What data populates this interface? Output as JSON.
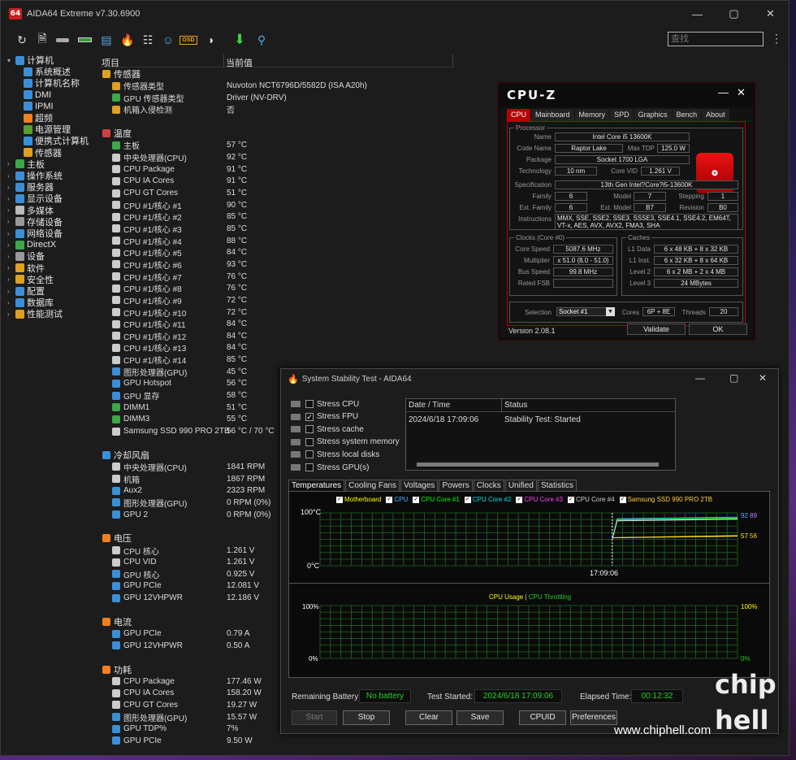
{
  "app": {
    "title": "AIDA64 Extreme v7.30.6900",
    "icon_text": "64"
  },
  "search": {
    "placeholder": "查找"
  },
  "toolbar": {
    "osd_label": "OSD"
  },
  "tree": [
    {
      "label": "计算机",
      "level": 0,
      "expanded": true,
      "color": "#3b8fd9"
    },
    {
      "label": "系统概述",
      "level": 1,
      "color": "#3b8fd9"
    },
    {
      "label": "计算机名称",
      "level": 1,
      "color": "#3b8fd9"
    },
    {
      "label": "DMI",
      "level": 1,
      "color": "#3b8fd9"
    },
    {
      "label": "IPMI",
      "level": 1,
      "color": "#3b8fd9"
    },
    {
      "label": "超频",
      "level": 1,
      "color": "#f08020"
    },
    {
      "label": "电源管理",
      "level": 1,
      "color": "#5aa030"
    },
    {
      "label": "便携式计算机",
      "level": 1,
      "color": "#3b8fd9"
    },
    {
      "label": "传感器",
      "level": 1,
      "color": "#e0a020"
    },
    {
      "label": "主板",
      "level": 0,
      "color": "#3ca84a"
    },
    {
      "label": "操作系统",
      "level": 0,
      "color": "#3b8fd9"
    },
    {
      "label": "服务器",
      "level": 0,
      "color": "#3b8fd9"
    },
    {
      "label": "显示设备",
      "level": 0,
      "color": "#3b8fd9"
    },
    {
      "label": "多媒体",
      "level": 0,
      "color": "#bbbbbb"
    },
    {
      "label": "存储设备",
      "level": 0,
      "color": "#999999"
    },
    {
      "label": "网络设备",
      "level": 0,
      "color": "#3b8fd9"
    },
    {
      "label": "DirectX",
      "level": 0,
      "color": "#3ca84a"
    },
    {
      "label": "设备",
      "level": 0,
      "color": "#999999"
    },
    {
      "label": "软件",
      "level": 0,
      "color": "#e0a020"
    },
    {
      "label": "安全性",
      "level": 0,
      "color": "#e0a020"
    },
    {
      "label": "配置",
      "level": 0,
      "color": "#3b8fd9"
    },
    {
      "label": "数据库",
      "level": 0,
      "color": "#3b8fd9"
    },
    {
      "label": "性能测试",
      "level": 0,
      "color": "#e0a020"
    }
  ],
  "list": {
    "col_item": "项目",
    "col_value": "当前值"
  },
  "sensors": [
    {
      "type": "section",
      "label": "传感器",
      "color": "#e0a020"
    },
    {
      "type": "item",
      "label": "传感器类型",
      "value": "Nuvoton NCT6796D/5582D  (ISA A20h)",
      "color": "#e0a020"
    },
    {
      "type": "item",
      "label": "GPU 传感器类型",
      "value": "Driver  (NV-DRV)",
      "color": "#3ca84a"
    },
    {
      "type": "item",
      "label": "机箱入侵检测",
      "value": "否",
      "color": "#e0a020"
    },
    {
      "type": "gap"
    },
    {
      "type": "section",
      "label": "温度",
      "color": "#d04040"
    },
    {
      "type": "item",
      "label": "主板",
      "value": "57 °C",
      "color": "#3ca84a"
    },
    {
      "type": "item",
      "label": "中央处理器(CPU)",
      "value": "92 °C",
      "color": "#cccccc"
    },
    {
      "type": "item",
      "label": "CPU Package",
      "value": "91 °C",
      "color": "#cccccc"
    },
    {
      "type": "item",
      "label": "CPU IA Cores",
      "value": "91 °C",
      "color": "#cccccc"
    },
    {
      "type": "item",
      "label": "CPU GT Cores",
      "value": "51 °C",
      "color": "#cccccc"
    },
    {
      "type": "item",
      "label": "CPU #1/核心 #1",
      "value": "90 °C",
      "color": "#cccccc"
    },
    {
      "type": "item",
      "label": "CPU #1/核心 #2",
      "value": "85 °C",
      "color": "#cccccc"
    },
    {
      "type": "item",
      "label": "CPU #1/核心 #3",
      "value": "85 °C",
      "color": "#cccccc"
    },
    {
      "type": "item",
      "label": "CPU #1/核心 #4",
      "value": "88 °C",
      "color": "#cccccc"
    },
    {
      "type": "item",
      "label": "CPU #1/核心 #5",
      "value": "84 °C",
      "color": "#cccccc"
    },
    {
      "type": "item",
      "label": "CPU #1/核心 #6",
      "value": "93 °C",
      "color": "#cccccc"
    },
    {
      "type": "item",
      "label": "CPU #1/核心 #7",
      "value": "76 °C",
      "color": "#cccccc"
    },
    {
      "type": "item",
      "label": "CPU #1/核心 #8",
      "value": "76 °C",
      "color": "#cccccc"
    },
    {
      "type": "item",
      "label": "CPU #1/核心 #9",
      "value": "72 °C",
      "color": "#cccccc"
    },
    {
      "type": "item",
      "label": "CPU #1/核心 #10",
      "value": "72 °C",
      "color": "#cccccc"
    },
    {
      "type": "item",
      "label": "CPU #1/核心 #11",
      "value": "84 °C",
      "color": "#cccccc"
    },
    {
      "type": "item",
      "label": "CPU #1/核心 #12",
      "value": "84 °C",
      "color": "#cccccc"
    },
    {
      "type": "item",
      "label": "CPU #1/核心 #13",
      "value": "84 °C",
      "color": "#cccccc"
    },
    {
      "type": "item",
      "label": "CPU #1/核心 #14",
      "value": "85 °C",
      "color": "#cccccc"
    },
    {
      "type": "item",
      "label": "图形处理器(GPU)",
      "value": "45 °C",
      "color": "#3b8fd9"
    },
    {
      "type": "item",
      "label": "GPU Hotspot",
      "value": "56 °C",
      "color": "#3b8fd9"
    },
    {
      "type": "item",
      "label": "GPU 显存",
      "value": "58 °C",
      "color": "#3b8fd9"
    },
    {
      "type": "item",
      "label": "DIMM1",
      "value": "51 °C",
      "color": "#3ca84a"
    },
    {
      "type": "item",
      "label": "DIMM3",
      "value": "55 °C",
      "color": "#3ca84a"
    },
    {
      "type": "item",
      "label": "Samsung SSD 990 PRO 2TB",
      "value": "56 °C / 70 °C",
      "color": "#cccccc"
    },
    {
      "type": "gap"
    },
    {
      "type": "section",
      "label": "冷却风扇",
      "color": "#3b8fd9"
    },
    {
      "type": "item",
      "label": "中央处理器(CPU)",
      "value": "1841 RPM",
      "color": "#cccccc"
    },
    {
      "type": "item",
      "label": "机箱",
      "value": "1867 RPM",
      "color": "#cccccc"
    },
    {
      "type": "item",
      "label": "Aux2",
      "value": "2323 RPM",
      "color": "#3b8fd9"
    },
    {
      "type": "item",
      "label": "图形处理器(GPU)",
      "value": "0 RPM  (0%)",
      "color": "#3b8fd9"
    },
    {
      "type": "item",
      "label": "GPU 2",
      "value": "0 RPM  (0%)",
      "color": "#3b8fd9"
    },
    {
      "type": "gap"
    },
    {
      "type": "section",
      "label": "电压",
      "color": "#f08020"
    },
    {
      "type": "item",
      "label": "CPU 核心",
      "value": "1.261 V",
      "color": "#cccccc"
    },
    {
      "type": "item",
      "label": "CPU VID",
      "value": "1.261 V",
      "color": "#cccccc"
    },
    {
      "type": "item",
      "label": "GPU 核心",
      "value": "0.925 V",
      "color": "#3b8fd9"
    },
    {
      "type": "item",
      "label": "GPU PCIe",
      "value": "12.081 V",
      "color": "#3b8fd9"
    },
    {
      "type": "item",
      "label": "GPU 12VHPWR",
      "value": "12.186 V",
      "color": "#3b8fd9"
    },
    {
      "type": "gap"
    },
    {
      "type": "section",
      "label": "电流",
      "color": "#f08020"
    },
    {
      "type": "item",
      "label": "GPU PCIe",
      "value": "0.79 A",
      "color": "#3b8fd9"
    },
    {
      "type": "item",
      "label": "GPU 12VHPWR",
      "value": "0.50 A",
      "color": "#3b8fd9"
    },
    {
      "type": "gap"
    },
    {
      "type": "section",
      "label": "功耗",
      "color": "#f08020"
    },
    {
      "type": "item",
      "label": "CPU Package",
      "value": "177.46 W",
      "color": "#cccccc"
    },
    {
      "type": "item",
      "label": "CPU IA Cores",
      "value": "158.20 W",
      "color": "#cccccc"
    },
    {
      "type": "item",
      "label": "CPU GT Cores",
      "value": "19.27 W",
      "color": "#cccccc"
    },
    {
      "type": "item",
      "label": "图形处理器(GPU)",
      "value": "15.57 W",
      "color": "#3b8fd9"
    },
    {
      "type": "item",
      "label": "GPU TDP%",
      "value": "7%",
      "color": "#3b8fd9"
    },
    {
      "type": "item",
      "label": "GPU PCIe",
      "value": "9.50 W",
      "color": "#3b8fd9"
    }
  ],
  "cpuz": {
    "title": "CPU-Z",
    "tabs": [
      "CPU",
      "Mainboard",
      "Memory",
      "SPD",
      "Graphics",
      "Bench",
      "About"
    ],
    "processor_group": "Processor",
    "name_label": "Name",
    "name": "Intel Core i5 13600K",
    "code_name_label": "Code Name",
    "code_name": "Raptor Lake",
    "max_tdp_label": "Max TDP",
    "max_tdp": "125.0 W",
    "package_label": "Package",
    "package": "Socket 1700 LGA",
    "technology_label": "Technology",
    "technology": "10 nm",
    "core_vid_label": "Core VID",
    "core_vid": "1.261 V",
    "specification_label": "Specification",
    "specification": "13th Gen Intel?Core?i5-13600K",
    "family_label": "Family",
    "family": "6",
    "model_label": "Model",
    "model": "7",
    "stepping_label": "Stepping",
    "stepping": "1",
    "ext_family_label": "Ext. Family",
    "ext_family": "6",
    "ext_model_label": "Ext. Model",
    "ext_model": "B7",
    "revision_label": "Revision",
    "revision": "B0",
    "instructions_label": "Instructions",
    "instructions": "MMX, SSE, SSE2, SSE3, SSSE3, SSE4.1, SSE4.2, EM64T, VT-x, AES, AVX, AVX2, FMA3, SHA",
    "clocks_group": "Clocks (Core #0)",
    "core_speed_label": "Core Speed",
    "core_speed": "5087.6 MHz",
    "multiplier_label": "Multiplier",
    "multiplier": "x 51.0 (8.0 - 51.0)",
    "bus_speed_label": "Bus Speed",
    "bus_speed": "99.8 MHz",
    "rated_fsb_label": "Rated FSB",
    "rated_fsb": "",
    "caches_group": "Caches",
    "l1d_label": "L1 Data",
    "l1d": "6 x 48 KB + 8 x 32 KB",
    "l1i_label": "L1 Inst.",
    "l1i": "6 x 32 KB + 8 x 64 KB",
    "l2_label": "Level 2",
    "l2": "6 x 2 MB + 2 x 4 MB",
    "l3_label": "Level 3",
    "l3": "24 MBytes",
    "selection_label": "Selection",
    "selection": "Socket #1",
    "cores_label": "Cores",
    "cores": "6P + 8E",
    "threads_label": "Threads",
    "threads": "20",
    "version": "Version 2.08.1",
    "validate": "Validate",
    "ok": "OK"
  },
  "sst": {
    "title": "System Stability Test - AIDA64",
    "stress": [
      {
        "label": "Stress CPU",
        "checked": false
      },
      {
        "label": "Stress FPU",
        "checked": true
      },
      {
        "label": "Stress cache",
        "checked": false
      },
      {
        "label": "Stress system memory",
        "checked": false
      },
      {
        "label": "Stress local disks",
        "checked": false
      },
      {
        "label": "Stress GPU(s)",
        "checked": false
      }
    ],
    "log_col_date": "Date / Time",
    "log_col_status": "Status",
    "log_date": "2024/6/18 17:09:06",
    "log_status": "Stability Test: Started",
    "tabs": [
      "Temperatures",
      "Cooling Fans",
      "Voltages",
      "Powers",
      "Clocks",
      "Unified",
      "Statistics"
    ],
    "temp_legend": [
      {
        "label": "Motherboard",
        "color": "#ffff00"
      },
      {
        "label": "CPU",
        "color": "#4fb3ff"
      },
      {
        "label": "CPU Core #1",
        "color": "#00ff00"
      },
      {
        "label": "CPU Core #2",
        "color": "#00e0e0"
      },
      {
        "label": "CPU Core #3",
        "color": "#ff40ff"
      },
      {
        "label": "CPU Core #4",
        "color": "#d0d0d0"
      },
      {
        "label": "Samsung SSD 990 PRO 2TB",
        "color": "#ffd040"
      }
    ],
    "temp_y_top": "100°C",
    "temp_y_bottom": "0°C",
    "temp_time": "17:09:06",
    "temp_right_a": "92",
    "temp_right_b": "89",
    "temp_right_c": "57",
    "temp_right_d": "56",
    "usage_legend_a": "CPU Usage",
    "usage_legend_sep": "|",
    "usage_legend_b": "CPU Throttling",
    "usage_y_top": "100%",
    "usage_y_bottom": "0%",
    "usage_right_top": "100%",
    "usage_right_bottom": "0%",
    "remaining_battery_label": "Remaining Battery:",
    "remaining_battery": "No battery",
    "test_started_label": "Test Started:",
    "test_started": "2024/6/18 17:09:06",
    "elapsed_label": "Elapsed Time:",
    "elapsed": "00:12:32",
    "buttons": {
      "start": "Start",
      "stop": "Stop",
      "clear": "Clear",
      "save": "Save",
      "cpuid": "CPUID",
      "preferences": "Preferences"
    }
  },
  "watermark": "www.chiphell.com",
  "logo": {
    "line1": "chip",
    "line2": "hell"
  }
}
